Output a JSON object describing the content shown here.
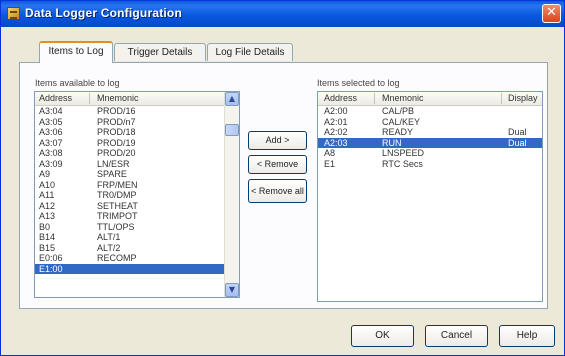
{
  "window": {
    "title": "Data Logger Configuration",
    "close_glyph": "✕"
  },
  "tabs": [
    {
      "label": "Items to Log",
      "active": true
    },
    {
      "label": "Trigger Details",
      "active": false
    },
    {
      "label": "Log File Details",
      "active": false
    }
  ],
  "available": {
    "label": "Items available to log",
    "headers": {
      "address": "Address",
      "mnemonic": "Mnemonic"
    },
    "rows": [
      {
        "address": "A3:04",
        "mnemonic": "PROD/16"
      },
      {
        "address": "A3:05",
        "mnemonic": "PROD/n7"
      },
      {
        "address": "A3:06",
        "mnemonic": "PROD/18"
      },
      {
        "address": "A3:07",
        "mnemonic": "PROD/19"
      },
      {
        "address": "A3:08",
        "mnemonic": "PROD/20"
      },
      {
        "address": "A3:09",
        "mnemonic": "LN/ESR"
      },
      {
        "address": "A9",
        "mnemonic": "SPARE"
      },
      {
        "address": "A10",
        "mnemonic": "FRP/MEN"
      },
      {
        "address": "A11",
        "mnemonic": "TR0/DMP"
      },
      {
        "address": "A12",
        "mnemonic": "SETHEAT"
      },
      {
        "address": "A13",
        "mnemonic": "TRIMPOT"
      },
      {
        "address": "B0",
        "mnemonic": "TTL/OPS"
      },
      {
        "address": "B14",
        "mnemonic": "ALT/1"
      },
      {
        "address": "B15",
        "mnemonic": "ALT/2"
      },
      {
        "address": "E0:06",
        "mnemonic": "RECOMP"
      },
      {
        "address": "E1:00",
        "mnemonic": "",
        "selected": true
      }
    ]
  },
  "selected": {
    "label": "Items selected to log",
    "headers": {
      "address": "Address",
      "mnemonic": "Mnemonic",
      "display": "Display"
    },
    "rows": [
      {
        "address": "A2:00",
        "mnemonic": "CAL/PB",
        "display": ""
      },
      {
        "address": "A2:01",
        "mnemonic": "CAL/KEY",
        "display": ""
      },
      {
        "address": "A2:02",
        "mnemonic": "READY",
        "display": "Dual"
      },
      {
        "address": "A2:03",
        "mnemonic": "RUN",
        "display": "Dual",
        "selected": true
      },
      {
        "address": "A8",
        "mnemonic": "LNSPEED",
        "display": ""
      },
      {
        "address": "E1",
        "mnemonic": "RTC Secs",
        "display": ""
      }
    ]
  },
  "actions": {
    "add": "Add >",
    "remove": "< Remove",
    "remove_all": "< Remove all"
  },
  "footer": {
    "ok": "OK",
    "cancel": "Cancel",
    "help": "Help"
  },
  "scroll": {
    "up_glyph": "▲",
    "down_glyph": "▼"
  }
}
